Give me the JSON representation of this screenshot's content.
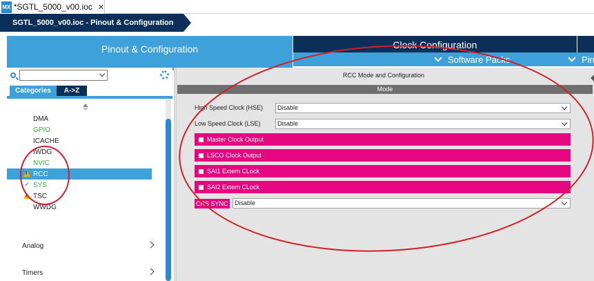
{
  "editor_tab": {
    "app_badge": "MX",
    "label": "*SGTL_5000_v00.ioc",
    "close": "✕"
  },
  "breadcrumb": {
    "label": "SGTL_5000_v00.ioc - Pinout & Configuration"
  },
  "main_tabs": {
    "pinout": "Pinout & Configuration",
    "clock": "Clock Configuration",
    "software_packs": "Software Packs",
    "pinout_partial": "Pin"
  },
  "left_panel": {
    "search_value": "",
    "categories_tab": "Categories",
    "az_tab": "A->Z",
    "items": [
      {
        "label": "DMA",
        "status": "none",
        "color": "#222222"
      },
      {
        "label": "GPIO",
        "status": "none",
        "color": "#3daa3d"
      },
      {
        "label": "ICACHE",
        "status": "none",
        "color": "#222222"
      },
      {
        "label": "IWDG",
        "status": "none",
        "color": "#222222"
      },
      {
        "label": "NVIC",
        "status": "none",
        "color": "#3daa3d"
      },
      {
        "label": "RCC",
        "status": "warning",
        "selected": true
      },
      {
        "label": "SYS",
        "status": "check",
        "color": "#3daa3d"
      },
      {
        "label": "TSC",
        "status": "warning",
        "color": "#222222"
      },
      {
        "label": "WWDG",
        "status": "none",
        "color": "#222222"
      }
    ],
    "sections": [
      "Analog",
      "Timers"
    ]
  },
  "right_panel": {
    "title": "RCC Mode and Configuration",
    "mode_header": "Mode",
    "hse": {
      "label": "High Speed Clock (HSE)",
      "value": "Disable"
    },
    "lse": {
      "label": "Low Speed Clock (LSE)",
      "value": "Disable"
    },
    "checkboxes": [
      "Master Clock Output",
      "LSCO Clock Output",
      "SAI1 Extern CLock",
      "SAI2 Extern CLock"
    ],
    "crs": {
      "label": "CRS SYNC",
      "value": "Disable"
    }
  },
  "colors": {
    "navy": "#0c2f5a",
    "blue": "#3ea1d9",
    "pink": "#e6067f",
    "annotation": "#d0202a"
  }
}
